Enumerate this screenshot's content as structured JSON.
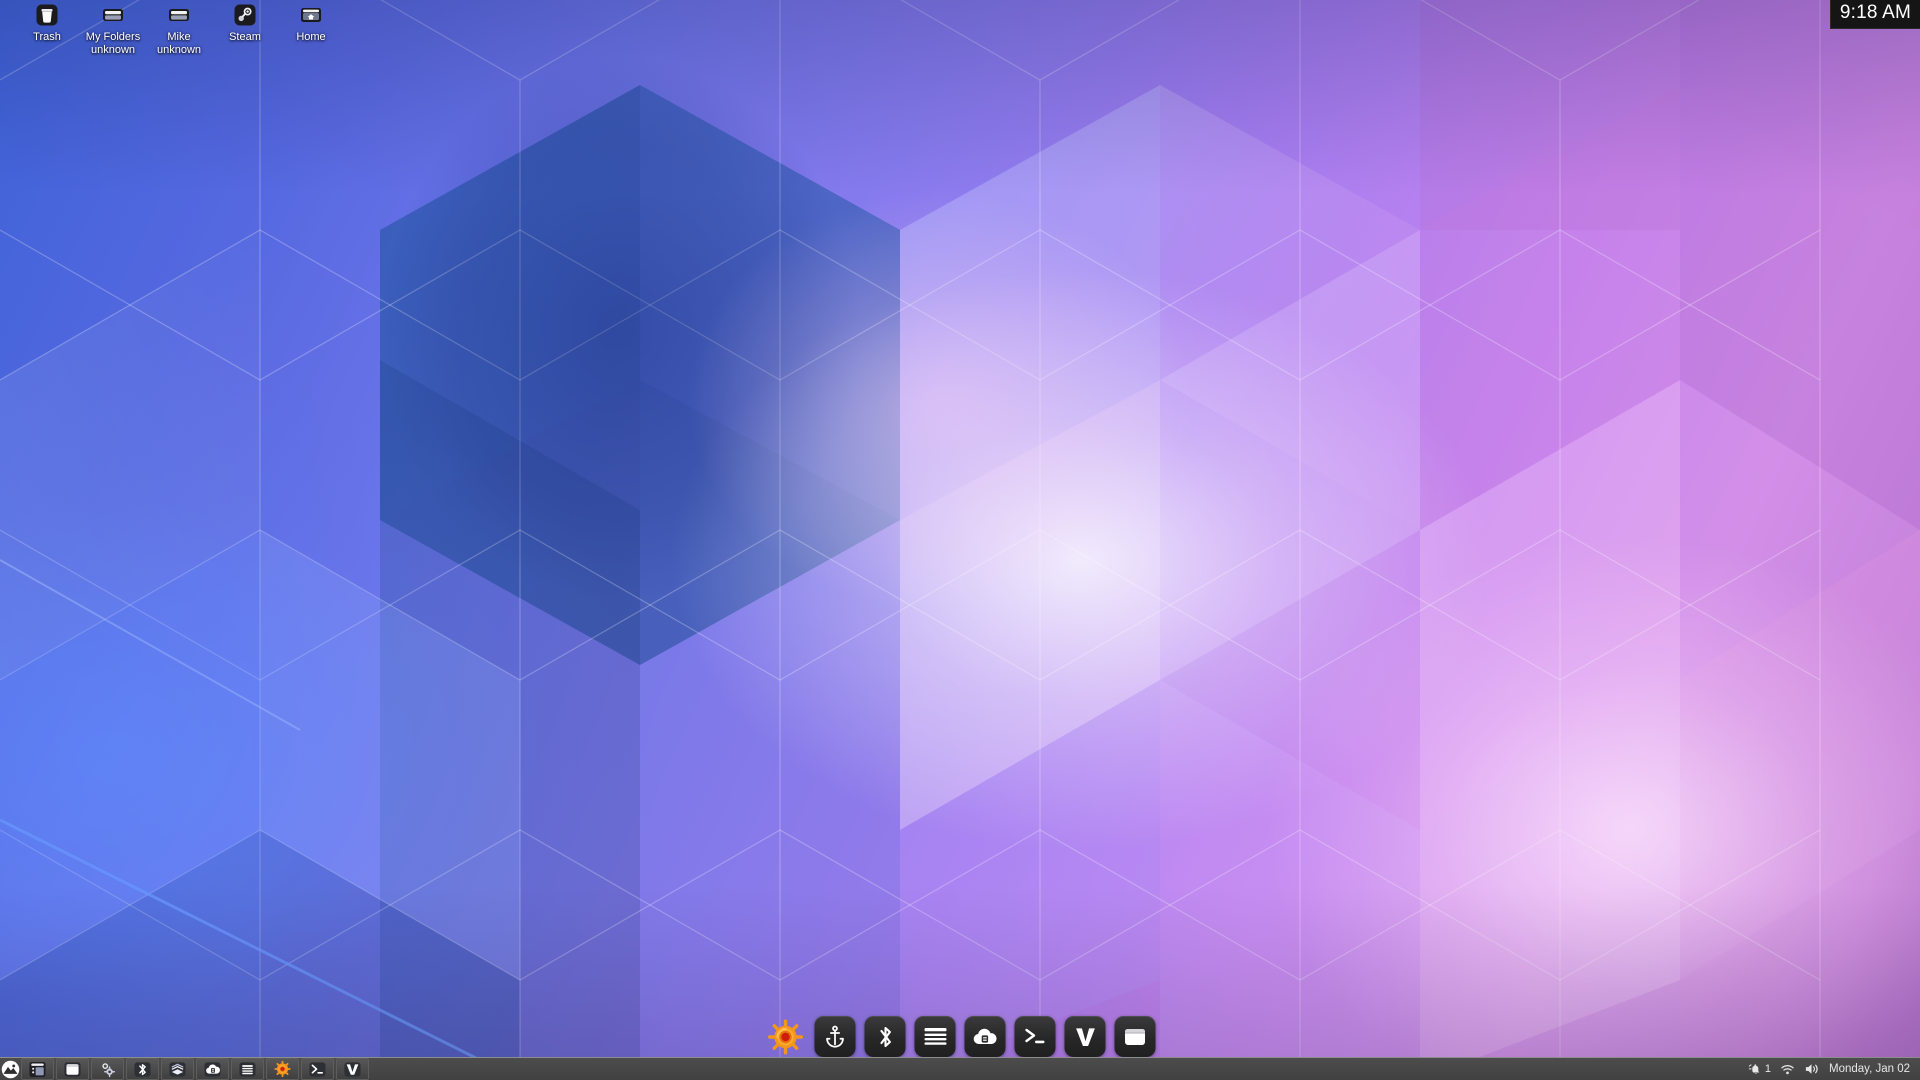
{
  "desktop": {
    "icons": [
      {
        "name": "Trash",
        "sub": "",
        "icon": "trash-icon"
      },
      {
        "name": "My Folders",
        "sub": "unknown",
        "icon": "drive-icon"
      },
      {
        "name": "Mike",
        "sub": "unknown",
        "icon": "drive-icon"
      },
      {
        "name": "Steam",
        "sub": "",
        "icon": "steam-icon"
      },
      {
        "name": "Home",
        "sub": "",
        "icon": "home-folder-icon"
      }
    ]
  },
  "clock_widget": {
    "time": "9:18 AM"
  },
  "dock": {
    "items": [
      {
        "label": "KDE Application Launcher",
        "icon": "kde-gear-icon",
        "style": "plain"
      },
      {
        "label": "Latte Dock",
        "icon": "anchor-icon",
        "style": "tile"
      },
      {
        "label": "Bluetooth",
        "icon": "bluetooth-icon",
        "style": "tile"
      },
      {
        "label": "Menu",
        "icon": "hamburger-icon",
        "style": "tile"
      },
      {
        "label": "Cloud Storage",
        "icon": "cloud-box-icon",
        "style": "tile"
      },
      {
        "label": "Terminal",
        "icon": "terminal-icon",
        "style": "tile"
      },
      {
        "label": "Vivaldi",
        "icon": "vivaldi-v-icon",
        "style": "tile"
      },
      {
        "label": "File Manager",
        "icon": "window-icon",
        "style": "tile"
      }
    ]
  },
  "panel": {
    "launchers": [
      {
        "label": "Application Menu",
        "icon": "mountain-menu-icon"
      }
    ],
    "tasks": [
      {
        "label": "List Window",
        "icon": "list-window-icon"
      },
      {
        "label": "File Window",
        "icon": "window-icon"
      },
      {
        "label": "Settings",
        "icon": "gear-dots-icon"
      },
      {
        "label": "Bluetooth",
        "icon": "bluetooth-icon"
      },
      {
        "label": "Media Stack",
        "icon": "stack-icon"
      },
      {
        "label": "Cloud Sync",
        "icon": "cloud-box-icon"
      },
      {
        "label": "Text Editor",
        "icon": "lines-icon"
      },
      {
        "label": "KDE",
        "icon": "kde-gear-icon"
      },
      {
        "label": "Terminal",
        "icon": "terminal-icon"
      },
      {
        "label": "Vivaldi",
        "icon": "vivaldi-v-icon"
      }
    ],
    "tray": {
      "notification_count": "1",
      "notification_icon": "bell-muted-icon",
      "network_icon": "wifi-icon",
      "volume_icon": "speaker-icon",
      "date": "Monday, Jan 02"
    }
  },
  "colors": {
    "panel_bg": "#474747",
    "panel_border": "#8d8d8d",
    "clock_bg": "#151515",
    "accent_orange": "#f59a13",
    "accent_red": "#c81e0e",
    "text_light": "#ffffff"
  }
}
